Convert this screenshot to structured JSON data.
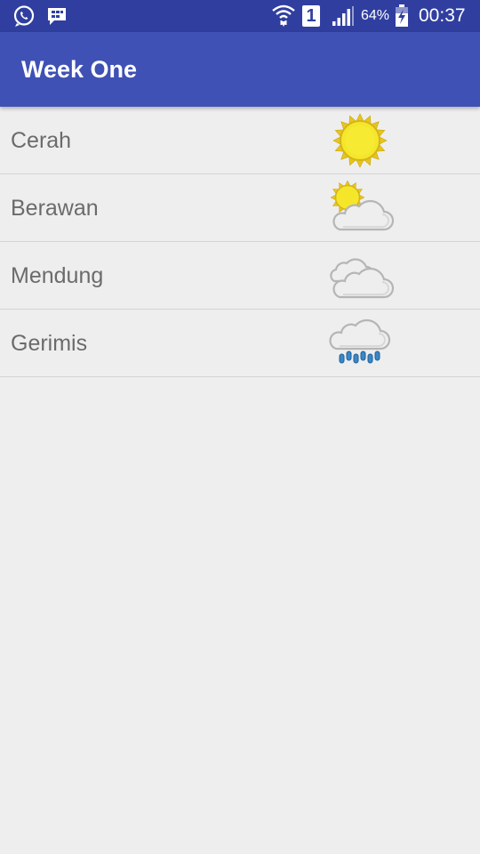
{
  "status_bar": {
    "left_icons": [
      "whatsapp-icon",
      "bbm-icon"
    ],
    "right_icons": [
      "wifi-icon",
      "sim-1-icon",
      "signal-icon",
      "battery-charging-icon"
    ],
    "sim_slot": "1",
    "battery": "64%",
    "time": "00:37"
  },
  "app_bar": {
    "title": "Week One"
  },
  "colors": {
    "status_bar": "#303f9f",
    "app_bar": "#3f51b5",
    "background": "#eeeeee",
    "label_text": "#6b6b6b",
    "divider": "#d4d4d4",
    "sun": "#f5e62a",
    "cloud": "#eeeeee",
    "rain": "#3a87c8"
  },
  "weather_list": [
    {
      "label": "Cerah",
      "icon": "sun-icon"
    },
    {
      "label": "Berawan",
      "icon": "partly-cloudy-icon"
    },
    {
      "label": "Mendung",
      "icon": "cloudy-icon"
    },
    {
      "label": "Gerimis",
      "icon": "drizzle-icon"
    }
  ]
}
